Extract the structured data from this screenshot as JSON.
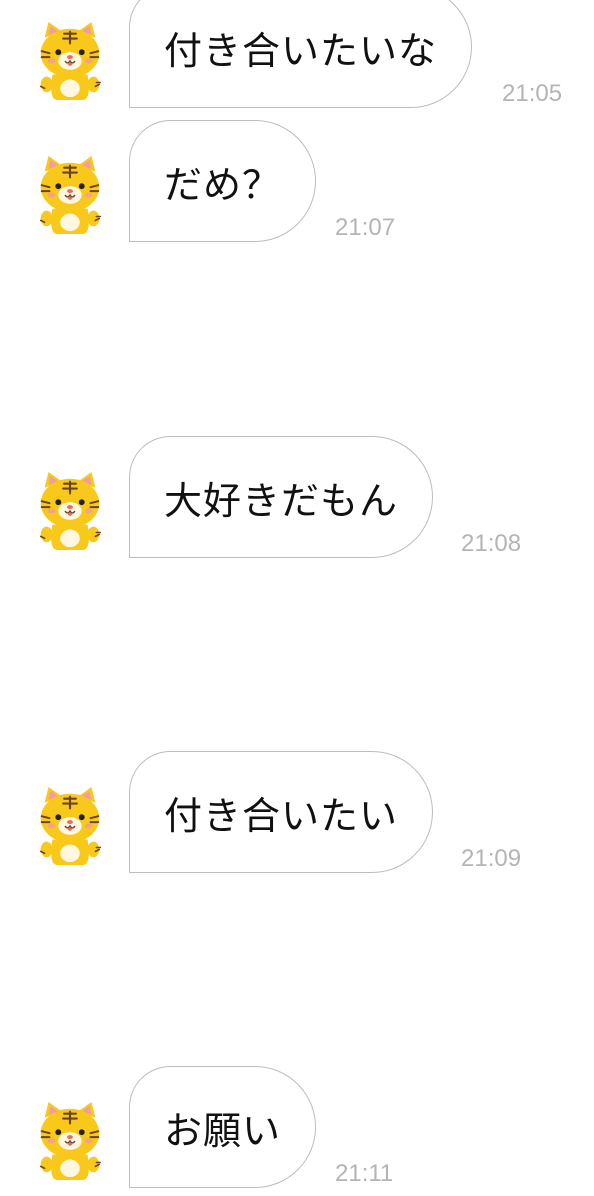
{
  "messages": [
    {
      "avatar": "tiger-avatar",
      "text": "付き合いたいな",
      "time": "21:05"
    },
    {
      "avatar": "tiger-avatar",
      "text": "だめ？",
      "time": "21:07"
    },
    {
      "avatar": "tiger-avatar",
      "text": "大好きだもん",
      "time": "21:08"
    },
    {
      "avatar": "tiger-avatar",
      "text": "付き合いたい",
      "time": "21:09"
    },
    {
      "avatar": "tiger-avatar",
      "text": "お願い",
      "time": "21:11"
    }
  ],
  "colors": {
    "bubble_border": "#bdbdbd",
    "time_text": "#b4b4b4",
    "tiger_body": "#f8c91a",
    "tiger_stripe": "#6b4226",
    "tiger_ear_inner": "#f49aa4"
  }
}
